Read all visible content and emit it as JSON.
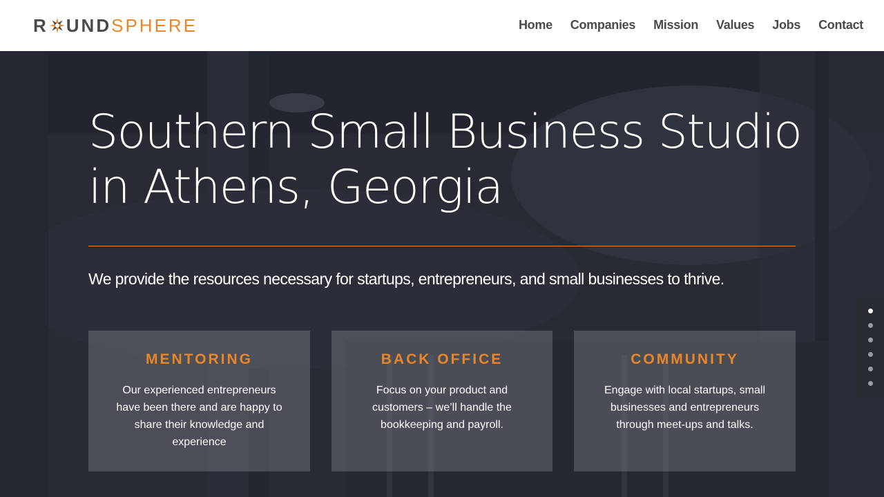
{
  "brand": {
    "logo_round": "R",
    "logo_und": "UND",
    "logo_sphere": "SPHERE",
    "accent_color": "#e8862a",
    "dark_color": "#4a4a4a"
  },
  "nav": {
    "items": [
      {
        "label": "Home"
      },
      {
        "label": "Companies"
      },
      {
        "label": "Mission"
      },
      {
        "label": "Values"
      },
      {
        "label": "Jobs"
      },
      {
        "label": "Contact"
      }
    ]
  },
  "hero": {
    "headline_line1": "Southern Small Business Studio",
    "headline_line2": "in Athens, Georgia",
    "subline": "We provide the resources necessary for startups, entrepreneurs, and small businesses to thrive."
  },
  "cards": [
    {
      "title": "MENTORING",
      "text": "Our experienced entrepreneurs have been there and are happy to share their knowledge and experience"
    },
    {
      "title": "BACK OFFICE",
      "text": "Focus on your product and customers – we’ll handle the bookkeeping and payroll."
    },
    {
      "title": "COMMUNITY",
      "text": "Engage with local startups, small businesses and entrepreneurs through meet-ups and talks."
    }
  ],
  "section_dots": {
    "count": 6,
    "active_index": 0
  }
}
